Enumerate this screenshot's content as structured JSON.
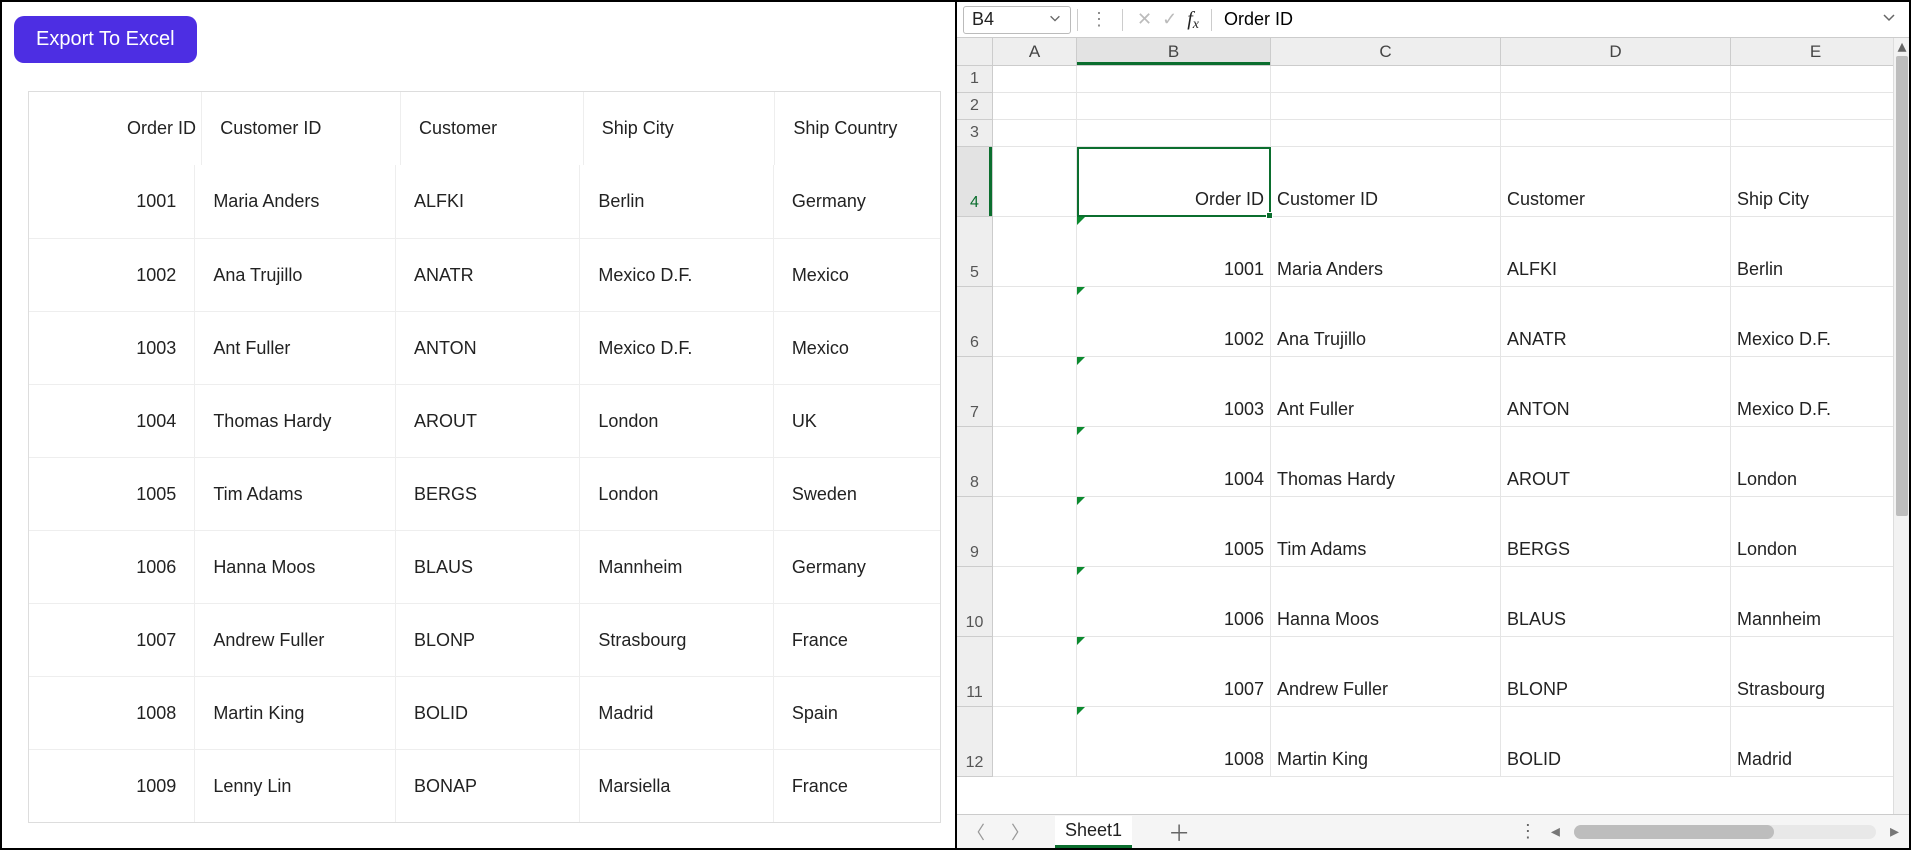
{
  "button": {
    "export_label": "Export To Excel"
  },
  "grid": {
    "headers": [
      "Order ID",
      "Customer ID",
      "Customer",
      "Ship City",
      "Ship Country"
    ],
    "rows": [
      {
        "order_id": "1001",
        "customer_id": "Maria Anders",
        "customer": "ALFKI",
        "ship_city": "Berlin",
        "ship_country": "Germany"
      },
      {
        "order_id": "1002",
        "customer_id": "Ana Trujillo",
        "customer": "ANATR",
        "ship_city": "Mexico D.F.",
        "ship_country": "Mexico"
      },
      {
        "order_id": "1003",
        "customer_id": "Ant Fuller",
        "customer": "ANTON",
        "ship_city": "Mexico D.F.",
        "ship_country": "Mexico"
      },
      {
        "order_id": "1004",
        "customer_id": "Thomas Hardy",
        "customer": "AROUT",
        "ship_city": "London",
        "ship_country": "UK"
      },
      {
        "order_id": "1005",
        "customer_id": "Tim Adams",
        "customer": "BERGS",
        "ship_city": "London",
        "ship_country": "Sweden"
      },
      {
        "order_id": "1006",
        "customer_id": "Hanna Moos",
        "customer": "BLAUS",
        "ship_city": "Mannheim",
        "ship_country": "Germany"
      },
      {
        "order_id": "1007",
        "customer_id": "Andrew Fuller",
        "customer": "BLONP",
        "ship_city": "Strasbourg",
        "ship_country": "France"
      },
      {
        "order_id": "1008",
        "customer_id": "Martin King",
        "customer": "BOLID",
        "ship_city": "Madrid",
        "ship_country": "Spain"
      },
      {
        "order_id": "1009",
        "customer_id": "Lenny Lin",
        "customer": "BONAP",
        "ship_city": "Marsiella",
        "ship_country": "France"
      }
    ]
  },
  "spreadsheet": {
    "name_box": "B4",
    "formula_value": "Order ID",
    "col_labels": [
      "A",
      "B",
      "C",
      "D",
      "E"
    ],
    "active_col": "B",
    "row_labels": [
      "1",
      "2",
      "3",
      "4",
      "5",
      "6",
      "7",
      "8",
      "9",
      "10",
      "11",
      "12"
    ],
    "active_row": "4",
    "sheet_name": "Sheet1",
    "header_row": {
      "b": "Order ID",
      "c": "Customer ID",
      "d": "Customer",
      "e": "Ship City"
    },
    "data_rows": [
      {
        "b": "1001",
        "c": "Maria Anders",
        "d": "ALFKI",
        "e": "Berlin"
      },
      {
        "b": "1002",
        "c": "Ana Trujillo",
        "d": "ANATR",
        "e": "Mexico D.F."
      },
      {
        "b": "1003",
        "c": "Ant Fuller",
        "d": "ANTON",
        "e": "Mexico D.F."
      },
      {
        "b": "1004",
        "c": "Thomas Hardy",
        "d": "AROUT",
        "e": "London"
      },
      {
        "b": "1005",
        "c": "Tim Adams",
        "d": "BERGS",
        "e": "London"
      },
      {
        "b": "1006",
        "c": "Hanna Moos",
        "d": "BLAUS",
        "e": "Mannheim"
      },
      {
        "b": "1007",
        "c": "Andrew Fuller",
        "d": "BLONP",
        "e": "Strasbourg"
      },
      {
        "b": "1008",
        "c": "Martin King",
        "d": "BOLID",
        "e": "Madrid"
      }
    ]
  }
}
